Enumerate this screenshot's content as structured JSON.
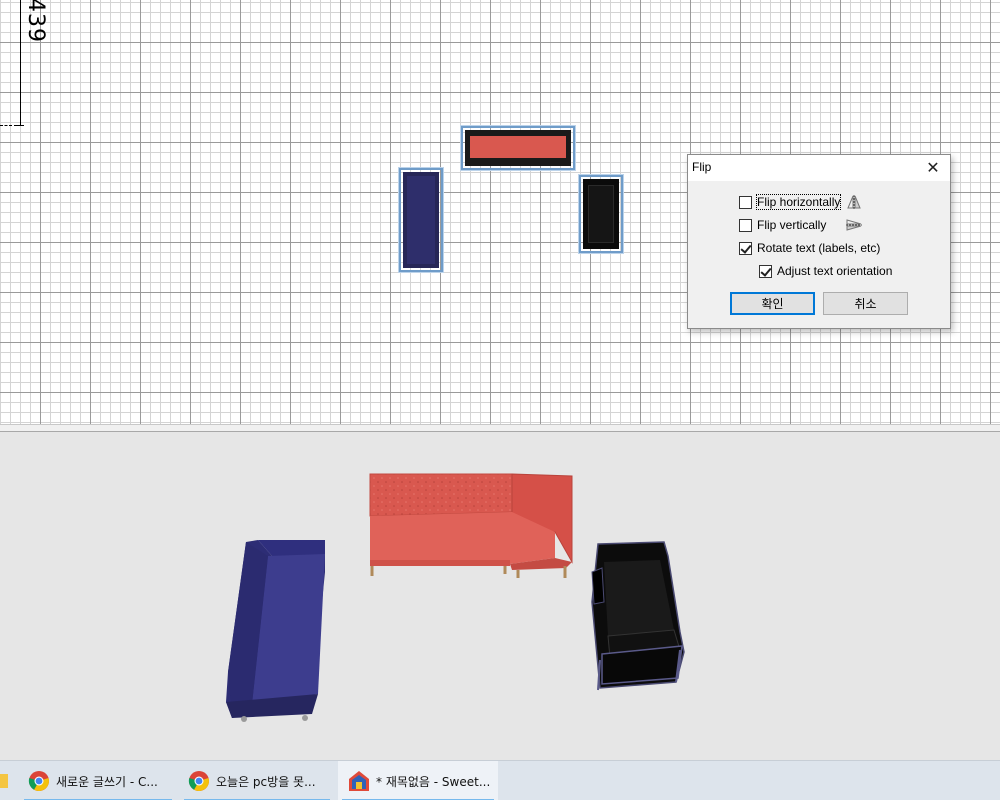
{
  "plan": {
    "dimension_label": "439"
  },
  "dialog": {
    "title": "Flip",
    "close_icon": "close-icon",
    "options": [
      {
        "label": "Flip horizontally",
        "checked": false
      },
      {
        "label": "Flip vertically",
        "checked": false
      },
      {
        "label": "Rotate text (labels, etc)",
        "checked": true
      },
      {
        "label": "Adjust text orientation",
        "checked": true
      }
    ],
    "ok_label": "확인",
    "cancel_label": "취소"
  },
  "colors": {
    "sofa_red": "#d9584f",
    "sofa_blue": "#35357f",
    "sofa_black": "#111111",
    "selection": "#6f9cc9",
    "default_button_border": "#0078d7"
  },
  "taskbar": {
    "items": [
      {
        "label": "새로운 글쓰기 - C...",
        "icon": "chrome-icon"
      },
      {
        "label": "오늘은 pc방을 못...",
        "icon": "chrome-icon"
      },
      {
        "label": "* 재목없음 - Sweet...",
        "icon": "sweet-home-3d-icon"
      }
    ]
  }
}
